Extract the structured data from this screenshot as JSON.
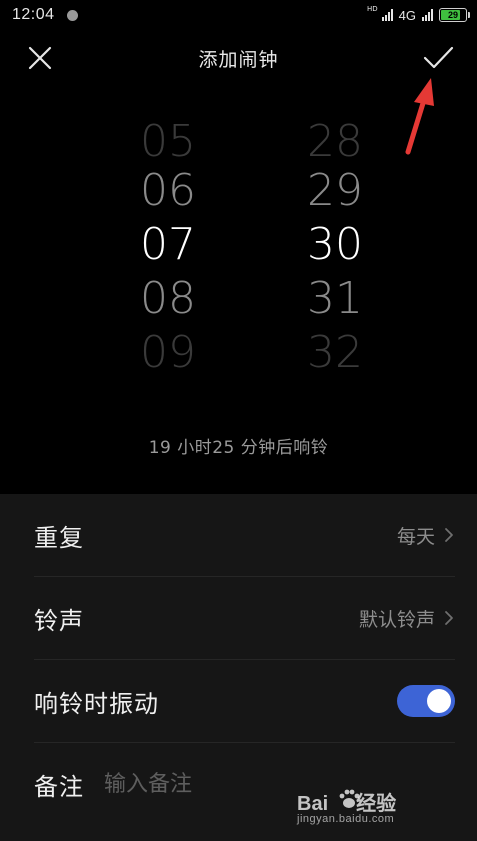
{
  "status_bar": {
    "time": "12:04",
    "hd_label": "HD",
    "network": "4G",
    "battery": "29"
  },
  "header": {
    "title": "添加闹钟"
  },
  "picker": {
    "hours": [
      "05",
      "06",
      "07",
      "08",
      "09"
    ],
    "minutes": [
      "28",
      "29",
      "30",
      "31",
      "32"
    ],
    "selected_hour": "07",
    "selected_minute": "30"
  },
  "countdown": "19 小时25 分钟后响铃",
  "settings": {
    "repeat": {
      "label": "重复",
      "value": "每天"
    },
    "ringtone": {
      "label": "铃声",
      "value": "默认铃声"
    },
    "vibrate": {
      "label": "响铃时振动",
      "on": true
    },
    "note": {
      "label": "备注",
      "placeholder": "输入备注"
    }
  },
  "watermark": {
    "logo_left": "Bai",
    "logo_right": "经验",
    "url": "jingyan.baidu.com"
  },
  "colors": {
    "background": "#000000",
    "panel": "#161616",
    "toggle_on": "#3d64d6",
    "annotation_arrow": "#e53935"
  }
}
